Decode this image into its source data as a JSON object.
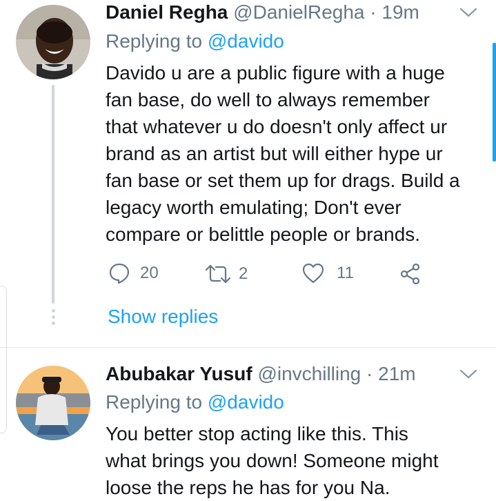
{
  "tweets": [
    {
      "name": "Daniel Regha",
      "handle": "@DanielRegha",
      "separator": "·",
      "time": "19m",
      "replying_prefix": "Replying to",
      "replying_to": "@davido",
      "text_lines": [
        "Davido u are a public figure with a huge",
        "fan base, do well to always remember",
        "that whatever u do doesn't only affect ur",
        "brand as an artist but will either hype ur",
        "fan base or set them up for drags. Build a",
        "legacy worth emulating; Don't ever",
        "compare or belittle people or brands."
      ],
      "replies": "20",
      "retweets": "2",
      "likes": "11",
      "show_replies": "Show replies"
    },
    {
      "name": "Abubakar Yusuf",
      "handle": "@invchilling",
      "separator": "·",
      "time": "21m",
      "replying_prefix": "Replying to",
      "replying_to": "@davido",
      "text_lines": [
        "You better stop acting like this. This",
        "what brings you down! Someone might",
        "loose the reps he has for you Na."
      ]
    }
  ],
  "icons": {
    "reply": "reply-icon",
    "retweet": "retweet-icon",
    "like": "heart-icon",
    "share": "share-icon",
    "caret": "chevron-down-icon"
  },
  "colors": {
    "accent": "#1da1f2",
    "secondary_text": "#657786",
    "primary_text": "#14171a",
    "divider": "#e1e8ed"
  }
}
